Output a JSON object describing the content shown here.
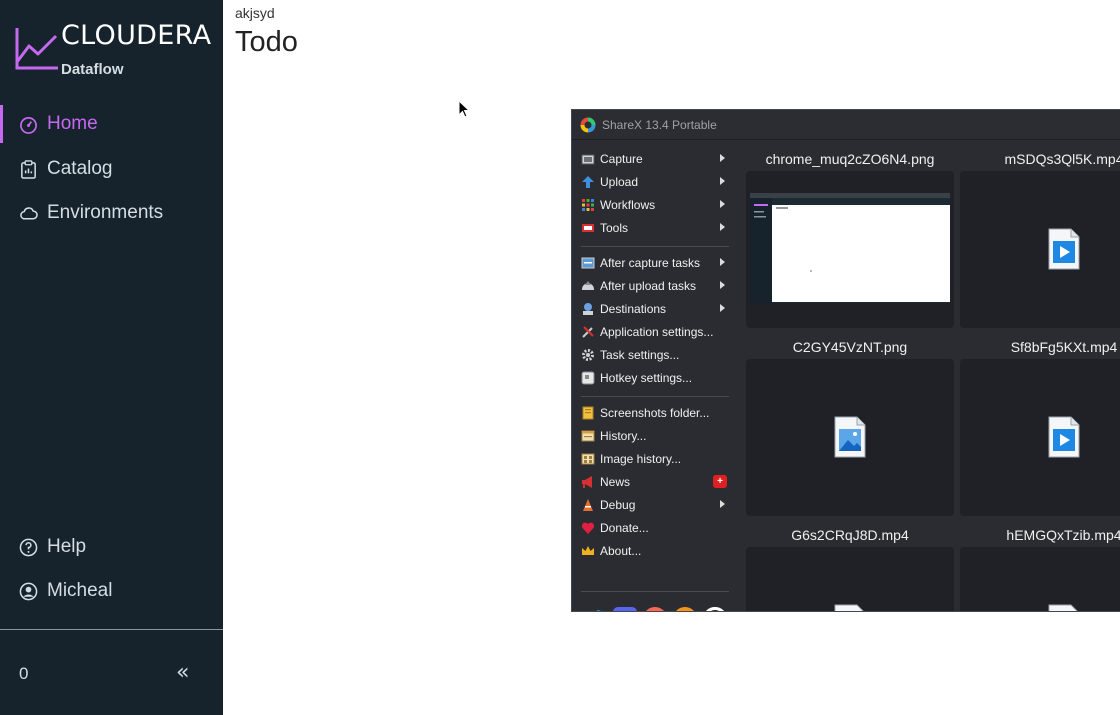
{
  "sidebar": {
    "brand": "CLOUDERA",
    "product": "Dataflow",
    "nav": [
      {
        "label": "Home",
        "active": true
      },
      {
        "label": "Catalog"
      },
      {
        "label": "Environments"
      }
    ],
    "bottom_nav": [
      {
        "label": "Help"
      },
      {
        "label": "Micheal"
      }
    ],
    "count": "0",
    "accent": "#c469f0"
  },
  "main": {
    "subtitle": "akjsyd",
    "title": "Todo"
  },
  "sharex": {
    "title": "ShareX 13.4 Portable",
    "menu": [
      {
        "label": "Capture",
        "icon": "capture-icon",
        "submenu": true
      },
      {
        "label": "Upload",
        "icon": "upload-icon",
        "submenu": true
      },
      {
        "label": "Workflows",
        "icon": "workflows-icon",
        "submenu": true
      },
      {
        "label": "Tools",
        "icon": "tools-icon",
        "submenu": true
      },
      {
        "label": "After capture tasks",
        "icon": "after-capture-icon",
        "submenu": true
      },
      {
        "label": "After upload tasks",
        "icon": "after-upload-icon",
        "submenu": true
      },
      {
        "label": "Destinations",
        "icon": "destinations-icon",
        "submenu": true
      },
      {
        "label": "Application settings...",
        "icon": "app-settings-icon"
      },
      {
        "label": "Task settings...",
        "icon": "task-settings-icon"
      },
      {
        "label": "Hotkey settings...",
        "icon": "hotkey-settings-icon"
      },
      {
        "label": "Screenshots folder...",
        "icon": "folder-icon"
      },
      {
        "label": "History...",
        "icon": "history-icon"
      },
      {
        "label": "Image history...",
        "icon": "image-history-icon"
      },
      {
        "label": "News",
        "icon": "news-icon",
        "badge": "+"
      },
      {
        "label": "Debug",
        "icon": "debug-icon",
        "submenu": true
      },
      {
        "label": "Donate...",
        "icon": "heart-icon"
      },
      {
        "label": "About...",
        "icon": "crown-icon"
      }
    ],
    "social": [
      "twitter-icon",
      "discord-icon",
      "patreon-icon",
      "bitcoin-icon",
      "github-icon"
    ],
    "files": [
      {
        "name": "chrome_muq2cZO6N4.png",
        "type": "screenshot"
      },
      {
        "name": "mSDQs3Ql5K.mp4",
        "type": "video"
      },
      {
        "name": "C2GY45VzNT.png",
        "type": "image"
      },
      {
        "name": "Sf8bFg5KXt.mp4",
        "type": "video"
      },
      {
        "name": "G6s2CRqJ8D.mp4",
        "type": "video"
      },
      {
        "name": "hEMGQxTzib.mp4",
        "type": "video"
      }
    ]
  }
}
